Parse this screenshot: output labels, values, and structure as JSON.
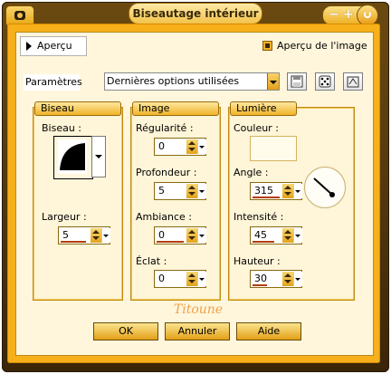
{
  "window": {
    "title": "Biseautage intérieur"
  },
  "preview": {
    "toggle_label": "Aperçu",
    "checkbox_label": "Aperçu de l'image",
    "checked": true
  },
  "params": {
    "label": "Paramètres",
    "preset_value": "Dernières options utilisées",
    "toolbar_icons": [
      "save-icon",
      "dice-icon",
      "reset-icon"
    ]
  },
  "groups": {
    "biseau": {
      "title": "Biseau",
      "biseau_label": "Biseau :",
      "largeur_label": "Largeur :",
      "largeur_value": "5"
    },
    "image": {
      "title": "Image",
      "regularite_label": "Régularité :",
      "regularite_value": "0",
      "profondeur_label": "Profondeur :",
      "profondeur_value": "5",
      "ambiance_label": "Ambiance :",
      "ambiance_value": "0",
      "eclat_label": "Éclat :",
      "eclat_value": "0"
    },
    "lumiere": {
      "title": "Lumière",
      "couleur_label": "Couleur :",
      "angle_label": "Angle :",
      "angle_value": "315",
      "intensite_label": "Intensité :",
      "intensite_value": "45",
      "hauteur_label": "Hauteur :",
      "hauteur_value": "30"
    }
  },
  "signature": "Titoune",
  "buttons": {
    "ok": "OK",
    "cancel": "Annuler",
    "help": "Aide"
  },
  "colors": {
    "frame": "#f7b01a",
    "panel": "#fff5d8",
    "accent_bar": "#b43b08"
  }
}
